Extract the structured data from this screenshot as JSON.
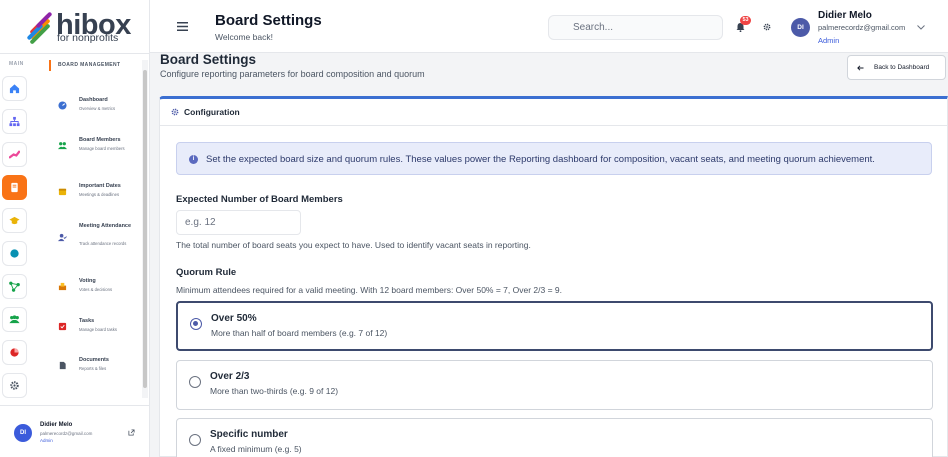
{
  "brand": {
    "name": "hibox",
    "tagline": "for nonprofits"
  },
  "sidebar": {
    "main_label": "MAIN",
    "section_title": "BOARD MANAGEMENT",
    "rail": [
      {
        "icon": "home-icon",
        "color": "#3b82f6"
      },
      {
        "icon": "sitemap-icon",
        "color": "#6366f1"
      },
      {
        "icon": "donation-icon",
        "color": "#ec4899"
      },
      {
        "icon": "board-icon",
        "color": "#ffffff",
        "active": true
      },
      {
        "icon": "graduation-icon",
        "color": "#eab308"
      },
      {
        "icon": "circle-icon",
        "color": "#0891b2"
      },
      {
        "icon": "network-icon",
        "color": "#16a34a"
      },
      {
        "icon": "team-icon",
        "color": "#16a34a"
      },
      {
        "icon": "pie-icon",
        "color": "#dc2626"
      },
      {
        "icon": "gear-icon",
        "color": "#4b5563"
      }
    ],
    "items": [
      {
        "title": "Dashboard",
        "desc": "Overview & metrics",
        "icon": "dashboard-icon",
        "color": "#3b6fd1"
      },
      {
        "title": "Board Members",
        "desc": "Manage board members",
        "icon": "users-icon",
        "color": "#16a34a"
      },
      {
        "title": "Important Dates",
        "desc": "Meetings & deadlines",
        "icon": "calendar-icon",
        "color": "#eab308"
      },
      {
        "title": "Meeting Attendance",
        "desc": "Track attendance records",
        "icon": "user-check-icon",
        "color": "#4c5aa8"
      },
      {
        "title": "Voting",
        "desc": "Votes & decisions",
        "icon": "vote-icon",
        "color": "#d97706"
      },
      {
        "title": "Tasks",
        "desc": "Manage board tasks",
        "icon": "tasks-icon",
        "color": "#dc2626"
      },
      {
        "title": "Documents",
        "desc": "Reports & files",
        "icon": "document-icon",
        "color": "#4b5563"
      }
    ],
    "user": {
      "initials": "DI",
      "name": "Didier Melo",
      "email": "palmerecordz@gmail.com",
      "role": "Admin"
    }
  },
  "header": {
    "title": "Board Settings",
    "subtitle": "Welcome back!",
    "search_placeholder": "Search...",
    "notification_count": "53",
    "user": {
      "initials": "DI",
      "name": "Didier Melo",
      "email": "palmerecordz@gmail.com",
      "role": "Admin"
    }
  },
  "page": {
    "title": "Board Settings",
    "subtitle": "Configure reporting parameters for board composition and quorum",
    "back_label": "Back to Dashboard"
  },
  "config": {
    "title": "Configuration",
    "info": "Set the expected board size and quorum rules. These values power the Reporting dashboard for composition, vacant seats, and meeting quorum achievement.",
    "expected_label": "Expected Number of Board Members",
    "expected_placeholder": "e.g. 12",
    "expected_help": "The total number of board seats you expect to have. Used to identify vacant seats in reporting.",
    "quorum_label": "Quorum Rule",
    "quorum_help": "Minimum attendees required for a valid meeting. With 12 board members: Over 50% = 7, Over 2/3 = 9.",
    "options": [
      {
        "title": "Over 50%",
        "desc": "More than half of board members (e.g. 7 of 12)",
        "selected": true
      },
      {
        "title": "Over 2/3",
        "desc": "More than two-thirds (e.g. 9 of 12)",
        "selected": false
      },
      {
        "title": "Specific number",
        "desc": "A fixed minimum (e.g. 5)",
        "selected": false
      }
    ]
  }
}
